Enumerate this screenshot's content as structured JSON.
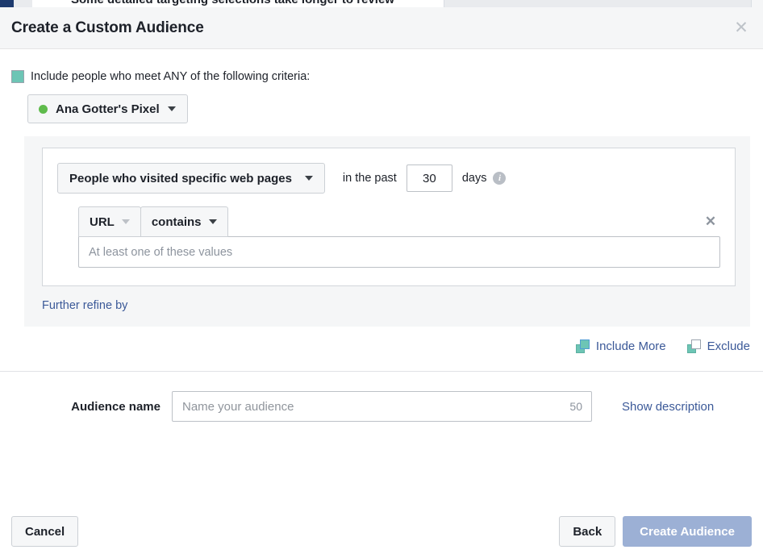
{
  "background": {
    "peeking_text": "Some detailed targeting selections take longer to review"
  },
  "dialog": {
    "title": "Create a Custom Audience",
    "close_icon": "close-icon"
  },
  "criteria": {
    "include_label": "Include people who meet ANY of the following criteria:",
    "pixel": {
      "name": "Ana Gotter's Pixel",
      "status_color": "#5fbb4c",
      "caret_icon": "chevron-down-icon"
    }
  },
  "rule": {
    "event": {
      "label": "People who visited specific web pages",
      "caret_icon": "chevron-down-icon"
    },
    "retention": {
      "prefix_label": "in the past",
      "days_value": "30",
      "suffix_label": "days",
      "info_icon": "info-icon"
    },
    "condition": {
      "field_label": "URL",
      "field_caret_icon": "chevron-down-icon",
      "operator_label": "contains",
      "operator_caret_icon": "chevron-down-icon",
      "values_placeholder": "At least one of these values",
      "values_value": "",
      "remove_icon": "close-icon"
    },
    "refine_link": "Further refine by"
  },
  "panel_actions": {
    "include_more": {
      "label": "Include More",
      "icon": "stacked-squares-filled-icon"
    },
    "exclude": {
      "label": "Exclude",
      "icon": "stacked-squares-hollow-icon"
    }
  },
  "audience_name": {
    "label": "Audience name",
    "placeholder": "Name your audience",
    "value": "",
    "char_counter": "50",
    "show_description_link": "Show description"
  },
  "footer": {
    "cancel_label": "Cancel",
    "back_label": "Back",
    "create_label": "Create Audience"
  },
  "colors": {
    "link": "#3b5998",
    "teal": "#6dc5b5",
    "primary_disabled": "#9cb0d5"
  }
}
